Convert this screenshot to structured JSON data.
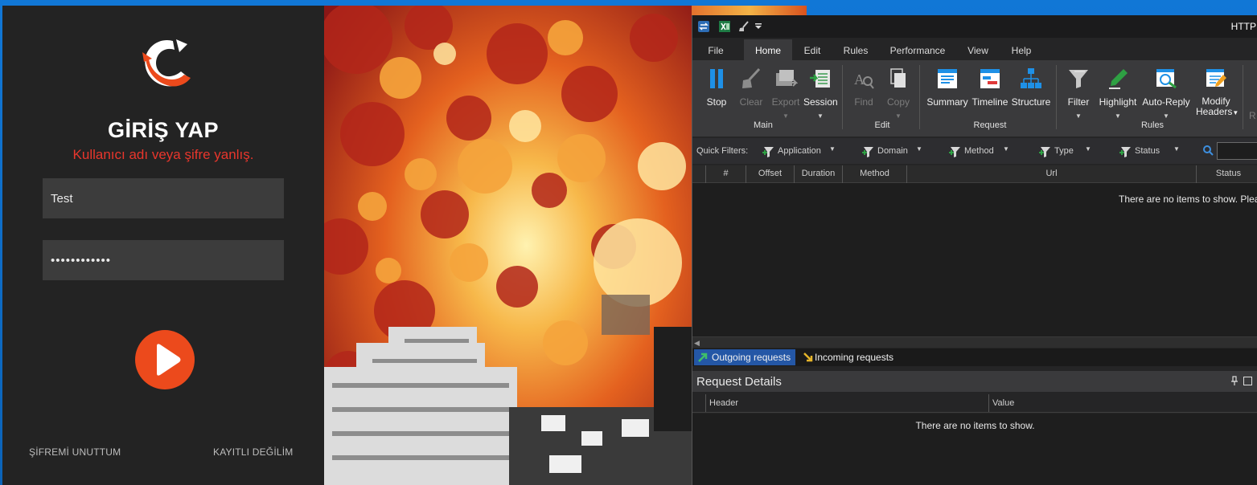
{
  "launcher": {
    "title": "GİRİŞ YAP",
    "error": "Kullanıcı adı veya şifre yanlış.",
    "username_value": "Test",
    "password_value": "••••••••••••",
    "forgot_link": "ŞİFREMİ UNUTTUM",
    "register_link": "KAYITLI DEĞİLİM",
    "accent_color": "#ec4a1c",
    "error_color": "#e8362c"
  },
  "fiddler": {
    "title": "HTTP",
    "menu_tabs": [
      "File",
      "Home",
      "Edit",
      "Rules",
      "Performance",
      "View",
      "Help"
    ],
    "active_tab": "Home",
    "ribbon": {
      "main": {
        "label": "Main",
        "buttons": [
          "Stop",
          "Clear",
          "Export",
          "Session"
        ]
      },
      "edit": {
        "label": "Edit",
        "buttons": [
          "Find",
          "Copy"
        ]
      },
      "request": {
        "label": "Request",
        "buttons": [
          "Summary",
          "Timeline",
          "Structure"
        ]
      },
      "rules": {
        "label": "Rules",
        "buttons": [
          "Filter",
          "Highlight",
          "Auto-Reply",
          "Modify",
          "Headers"
        ]
      },
      "overflow": "R"
    },
    "quick_filters": {
      "label": "Quick Filters:",
      "items": [
        "Application",
        "Domain",
        "Method",
        "Type",
        "Status"
      ]
    },
    "columns": [
      "#",
      "Offset",
      "Duration",
      "Method",
      "Url",
      "Status"
    ],
    "empty_sessions": "There are no items to show. Pleas",
    "request_tabs": [
      "Outgoing requests",
      "Incoming requests"
    ],
    "details": {
      "title": "Request Details",
      "columns": [
        "Header",
        "Value"
      ],
      "empty": "There are no items to show."
    }
  }
}
